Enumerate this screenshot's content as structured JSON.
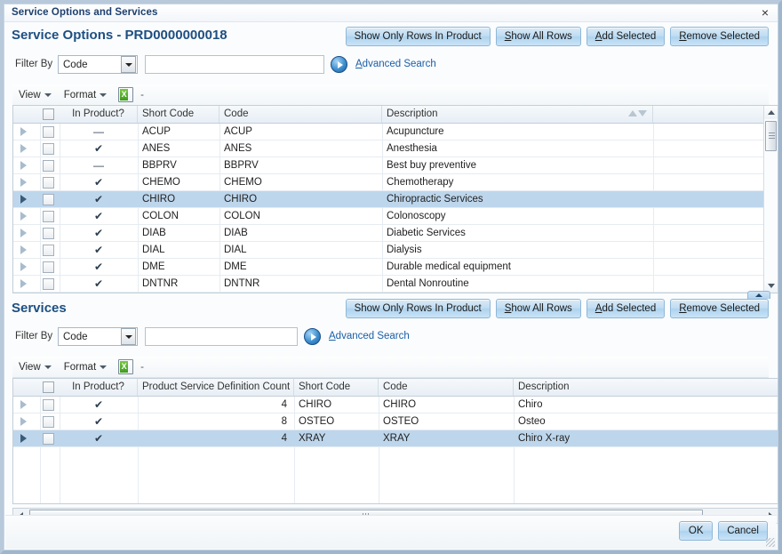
{
  "window": {
    "title": "Service Options and Services",
    "close_icon": "close-icon",
    "close_glyph": "×"
  },
  "colors": {
    "accent": "#1d4f82",
    "link": "#1a5fa8",
    "button_face": "#bedcf2",
    "selected_row": "#bdd6ec",
    "header": "#e7eef5"
  },
  "panel1": {
    "title": "Service Options - PRD0000000018",
    "buttons": [
      {
        "label": "Show Only Rows In Product",
        "accel": "",
        "name": "show-only-rows-in-product-button"
      },
      {
        "label": "Show All Rows",
        "accel": "S",
        "name": "show-all-rows-button"
      },
      {
        "label": "Add Selected",
        "accel": "A",
        "name": "add-selected-button"
      },
      {
        "label": "Remove Selected",
        "accel": "R",
        "name": "remove-selected-button"
      }
    ],
    "filter": {
      "label": "Filter By",
      "select_value": "Code",
      "input_value": "",
      "input_placeholder": "",
      "go_icon": "go-arrow-icon",
      "advanced_search": "Advanced Search",
      "advanced_accel": "A"
    },
    "toolbar": {
      "view_label": "View",
      "format_label": "Format",
      "export_icon": "export-to-excel-icon",
      "separator_label": "-"
    },
    "grid": {
      "columns": [
        "In Product?",
        "Short Code",
        "Code",
        "Description"
      ],
      "sort_column": "Description",
      "sort_icons": [
        "sort-ascending-icon",
        "sort-descending-icon"
      ],
      "rows": [
        {
          "in_product": "—",
          "short_code": "ACUP",
          "code": "ACUP",
          "description": "Acupuncture",
          "selected": false
        },
        {
          "in_product": "✔",
          "short_code": "ANES",
          "code": "ANES",
          "description": "Anesthesia",
          "selected": false
        },
        {
          "in_product": "—",
          "short_code": "BBPRV",
          "code": "BBPRV",
          "description": "Best buy preventive",
          "selected": false
        },
        {
          "in_product": "✔",
          "short_code": "CHEMO",
          "code": "CHEMO",
          "description": "Chemotherapy",
          "selected": false
        },
        {
          "in_product": "✔",
          "short_code": "CHIRO",
          "code": "CHIRO",
          "description": "Chiropractic Services",
          "selected": true
        },
        {
          "in_product": "✔",
          "short_code": "COLON",
          "code": "COLON",
          "description": "Colonoscopy",
          "selected": false
        },
        {
          "in_product": "✔",
          "short_code": "DIAB",
          "code": "DIAB",
          "description": "Diabetic Services",
          "selected": false
        },
        {
          "in_product": "✔",
          "short_code": "DIAL",
          "code": "DIAL",
          "description": "Dialysis",
          "selected": false
        },
        {
          "in_product": "✔",
          "short_code": "DME",
          "code": "DME",
          "description": "Durable medical equipment",
          "selected": false
        },
        {
          "in_product": "✔",
          "short_code": "DNTNR",
          "code": "DNTNR",
          "description": "Dental Nonroutine",
          "selected": false
        }
      ]
    }
  },
  "panel2": {
    "title": "Services",
    "buttons": [
      {
        "label": "Show Only Rows In Product",
        "accel": "",
        "name": "show-only-rows-in-product-button"
      },
      {
        "label": "Show All Rows",
        "accel": "S",
        "name": "show-all-rows-button"
      },
      {
        "label": "Add Selected",
        "accel": "A",
        "name": "add-selected-button"
      },
      {
        "label": "Remove Selected",
        "accel": "R",
        "name": "remove-selected-button"
      }
    ],
    "filter": {
      "label": "Filter By",
      "select_value": "Code",
      "input_value": "",
      "input_placeholder": "",
      "go_icon": "go-arrow-icon",
      "advanced_search": "Advanced Search",
      "advanced_accel": "A"
    },
    "toolbar": {
      "view_label": "View",
      "format_label": "Format",
      "export_icon": "export-to-excel-icon",
      "separator_label": "-"
    },
    "grid": {
      "columns": [
        "In Product?",
        "Product Service Definition Count",
        "Short Code",
        "Code",
        "Description"
      ],
      "rows": [
        {
          "in_product": "✔",
          "count": "4",
          "short_code": "CHIRO",
          "code": "CHIRO",
          "description": "Chiro",
          "selected": false
        },
        {
          "in_product": "✔",
          "count": "8",
          "short_code": "OSTEO",
          "code": "OSTEO",
          "description": "Osteo",
          "selected": false
        },
        {
          "in_product": "✔",
          "count": "4",
          "short_code": "XRAY",
          "code": "XRAY",
          "description": "Chiro X-ray",
          "selected": true
        }
      ]
    }
  },
  "footer": {
    "ok_label": "OK",
    "cancel_label": "Cancel",
    "resize_grip": "resize-grip-icon"
  }
}
